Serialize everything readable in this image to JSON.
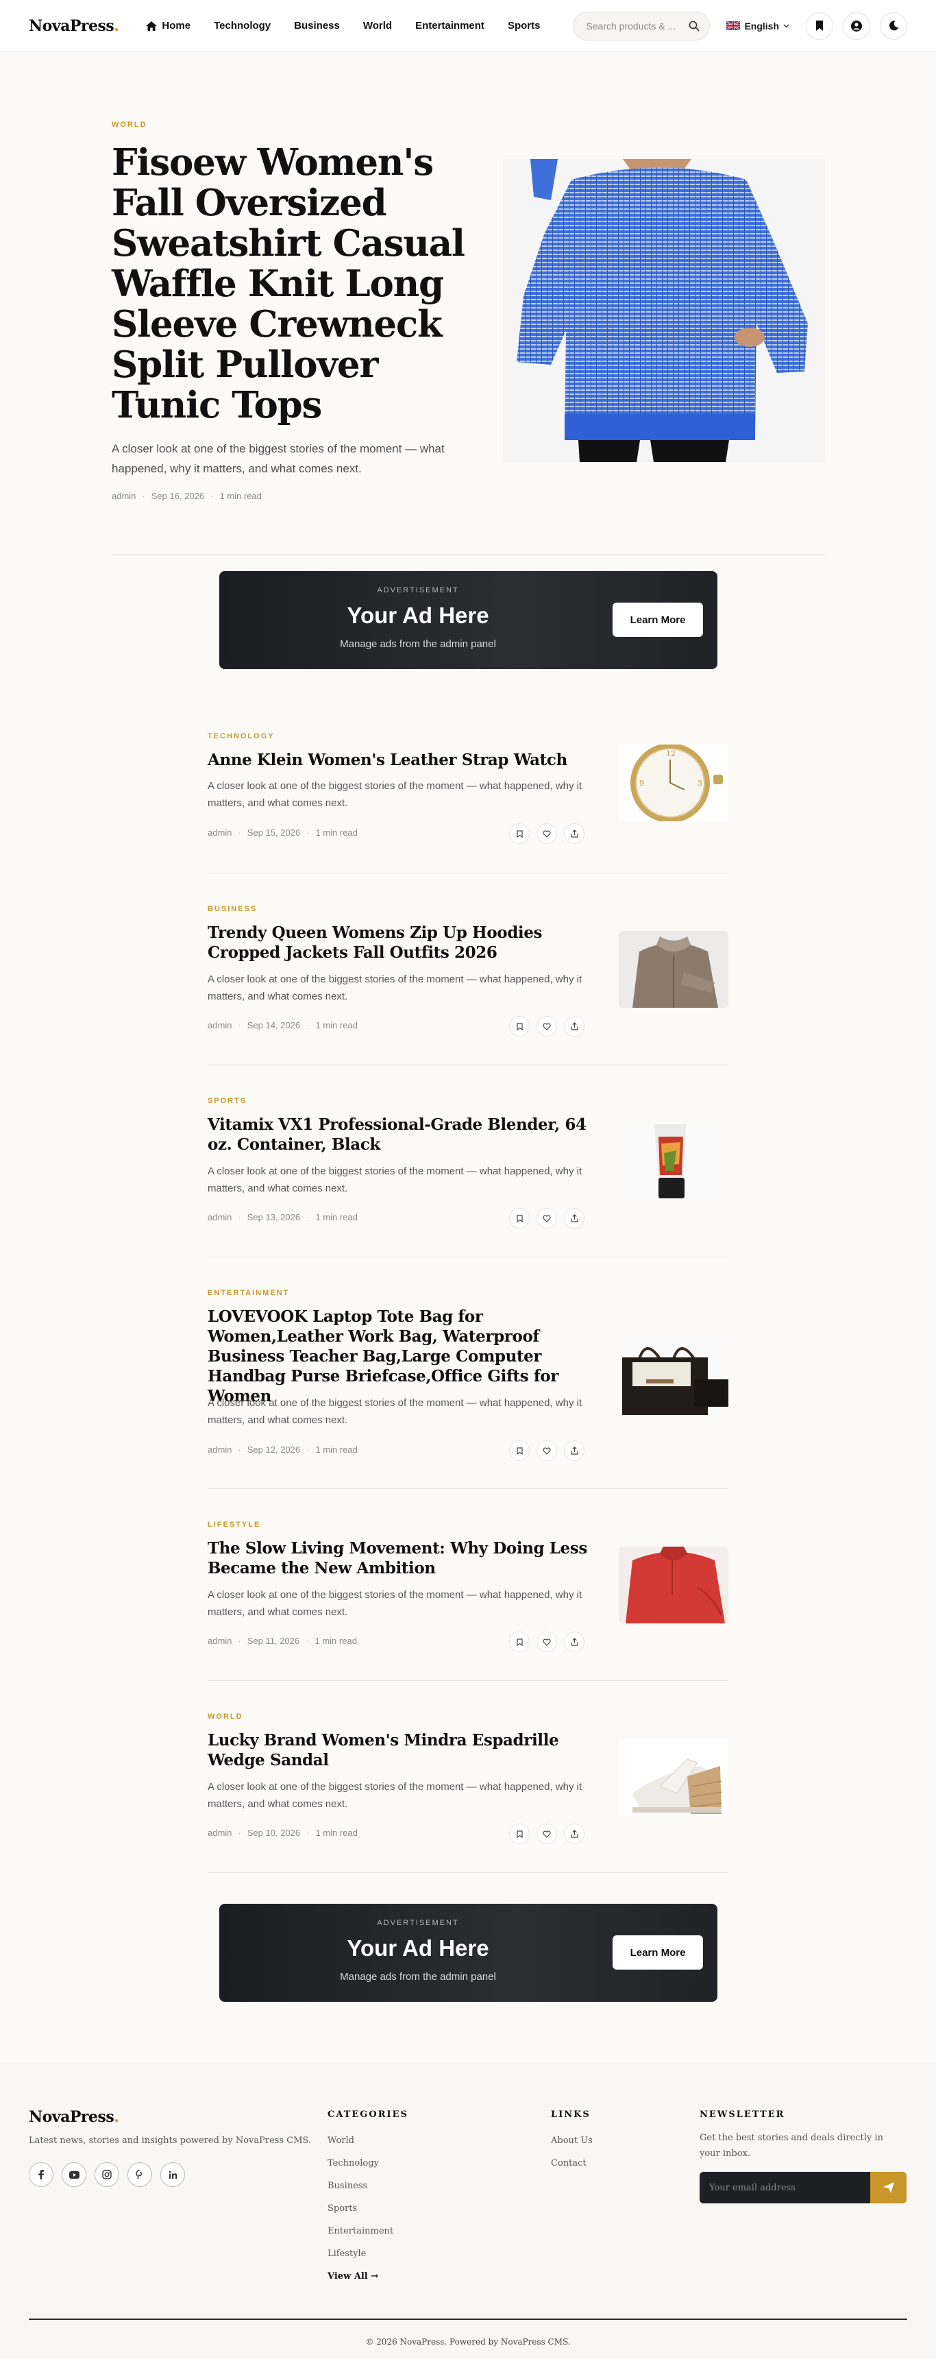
{
  "header": {
    "logo": "NovaPress",
    "logo_dot": ".",
    "nav": [
      {
        "label": "Home",
        "icon": "home-icon"
      },
      {
        "label": "Technology"
      },
      {
        "label": "Business"
      },
      {
        "label": "World"
      },
      {
        "label": "Entertainment"
      },
      {
        "label": "Sports"
      }
    ],
    "search_placeholder": "Search products & ...",
    "language": "English",
    "icons": [
      "bookmark-icon",
      "user-icon",
      "moon-icon"
    ]
  },
  "hero": {
    "category": "WORLD",
    "title": "Fisoew Women's Fall Oversized Sweatshirt Casual Waffle Knit Long Sleeve Crewneck Split Pullover Tunic Tops",
    "excerpt": "A closer look at one of the biggest stories of the moment — what happened, why it matters, and what comes next.",
    "author": "admin",
    "date": "Sep 16, 2026",
    "read": "1 min read"
  },
  "ads": [
    {
      "label": "ADVERTISEMENT",
      "title": "Your Ad Here",
      "subtitle": "Manage ads from the admin panel",
      "button": "Learn More"
    },
    {
      "label": "ADVERTISEMENT",
      "title": "Your Ad Here",
      "subtitle": "Manage ads from the admin panel",
      "button": "Learn More"
    }
  ],
  "articles": [
    {
      "category": "TECHNOLOGY",
      "title": "Anne Klein Women's Leather Strap Watch",
      "excerpt": "A closer look at one of the biggest stories of the moment — what happened, why it matters, and what comes next.",
      "author": "admin",
      "date": "Sep 15, 2026",
      "read": "1 min read"
    },
    {
      "category": "BUSINESS",
      "title": "Trendy Queen Womens Zip Up Hoodies Cropped Jackets Fall Outfits 2026",
      "excerpt": "A closer look at one of the biggest stories of the moment — what happened, why it matters, and what comes next.",
      "author": "admin",
      "date": "Sep 14, 2026",
      "read": "1 min read"
    },
    {
      "category": "SPORTS",
      "title": "Vitamix VX1 Professional-Grade Blender, 64 oz. Container, Black",
      "excerpt": "A closer look at one of the biggest stories of the moment — what happened, why it matters, and what comes next.",
      "author": "admin",
      "date": "Sep 13, 2026",
      "read": "1 min read"
    },
    {
      "category": "ENTERTAINMENT",
      "title": "LOVEVOOK Laptop Tote Bag for Women,Leather Work Bag, Waterproof Business Teacher Bag,Large Computer Handbag Purse Briefcase,Office Gifts for Women",
      "excerpt": "A closer look at one of the biggest stories of the moment — what happened, why it matters, and what comes next.",
      "author": "admin",
      "date": "Sep 12, 2026",
      "read": "1 min read"
    },
    {
      "category": "LIFESTYLE",
      "title": "The Slow Living Movement: Why Doing Less Became the New Ambition",
      "excerpt": "A closer look at one of the biggest stories of the moment — what happened, why it matters, and what comes next.",
      "author": "admin",
      "date": "Sep 11, 2026",
      "read": "1 min read"
    },
    {
      "category": "WORLD",
      "title": "Lucky Brand Women's Mindra Espadrille Wedge Sandal",
      "excerpt": "A closer look at one of the biggest stories of the moment — what happened, why it matters, and what comes next.",
      "author": "admin",
      "date": "Sep 10, 2026",
      "read": "1 min read"
    }
  ],
  "footer": {
    "logo": "NovaPress",
    "logo_dot": ".",
    "tagline": "Latest news, stories and insights powered by NovaPress CMS.",
    "social_icons": [
      "facebook-icon",
      "youtube-icon",
      "instagram-icon",
      "pinterest-icon",
      "linkedin-icon"
    ],
    "categories_heading": "CATEGORIES",
    "categories": [
      "World",
      "Technology",
      "Business",
      "Sports",
      "Entertainment",
      "Lifestyle",
      "View All →"
    ],
    "links_heading": "LINKS",
    "links": [
      "About Us",
      "Contact"
    ],
    "newsletter_heading": "NEWSLETTER",
    "newsletter_text": "Get the best stories and deals directly in your inbox.",
    "newsletter_placeholder": "Your email address",
    "copyright": "© 2026 NovaPress. Powered by NovaPress CMS."
  },
  "colors": {
    "accent": "#c9962a",
    "dark": "#1d1f23",
    "background": "#fbfaf7"
  }
}
